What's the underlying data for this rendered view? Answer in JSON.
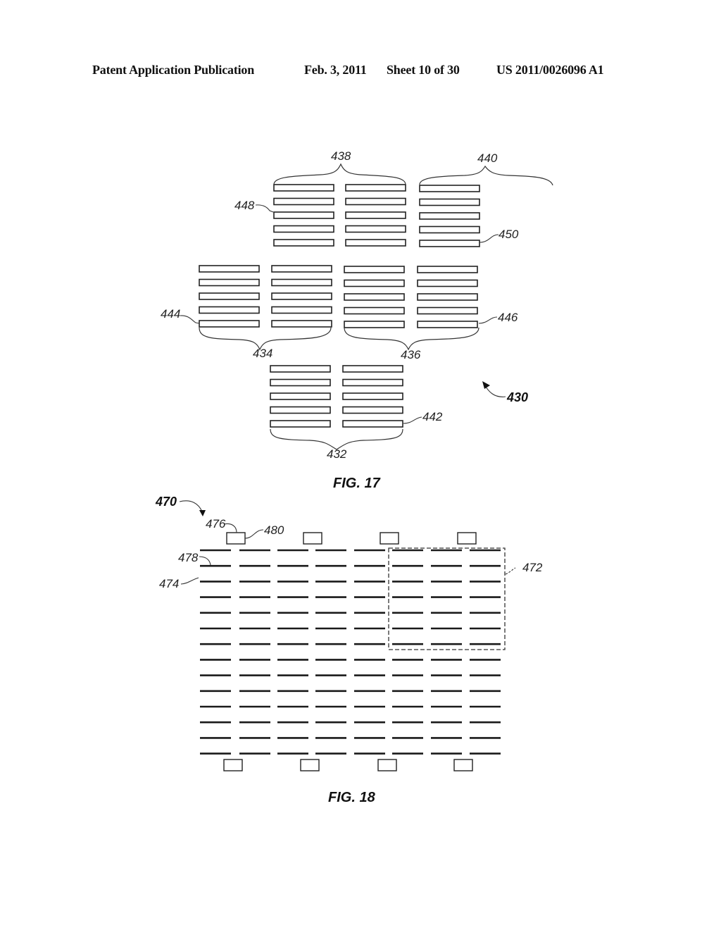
{
  "header": {
    "publication_type": "Patent Application Publication",
    "date": "Feb. 3, 2011",
    "sheet": "Sheet 10 of 30",
    "publication_number": "US 2011/0026096 A1"
  },
  "figures": [
    {
      "id": "fig17",
      "caption": "FIG. 17",
      "reference_label": "430",
      "description": "Arrangement of bar-shaped elements in groups of two columns by five rows",
      "groups": [
        {
          "label": "432",
          "columns": 2,
          "rows": 5,
          "position": "bottom"
        },
        {
          "label": "434",
          "columns": 2,
          "rows": 5,
          "position": "middle-left"
        },
        {
          "label": "436",
          "columns": 2,
          "rows": 5,
          "position": "middle-right"
        },
        {
          "label": "438",
          "columns": 2,
          "rows": 5,
          "position": "top-center"
        },
        {
          "label": "440",
          "columns": 1,
          "rows": 5,
          "position": "top-right"
        }
      ],
      "element_labels": [
        "442",
        "444",
        "446",
        "448",
        "450"
      ]
    },
    {
      "id": "fig18",
      "caption": "FIG. 18",
      "reference_label": "470",
      "description": "Grid of line segments with contact pads above and below",
      "grid": {
        "rows": 14,
        "columns": 8
      },
      "top_pads": 4,
      "bottom_pads": 4,
      "highlight_region": {
        "label": "472",
        "rows": 7,
        "columns": 3,
        "style": "dashed"
      },
      "element_labels": [
        "472",
        "474",
        "476",
        "478",
        "480"
      ]
    }
  ]
}
